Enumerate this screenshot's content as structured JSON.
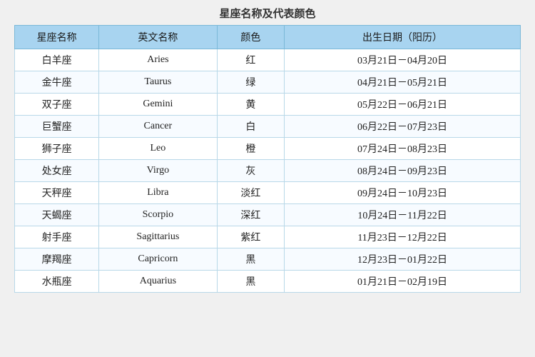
{
  "title": "星座名称及代表颜色",
  "headers": {
    "zh_name": "星座名称",
    "en_name": "英文名称",
    "color": "颜色",
    "date": "出生日期（阳历）"
  },
  "rows": [
    {
      "zh": "白羊座",
      "en": "Aries",
      "color": "红",
      "date": "03月21日－04月20日"
    },
    {
      "zh": "金牛座",
      "en": "Taurus",
      "color": "绿",
      "date": "04月21日－05月21日"
    },
    {
      "zh": "双子座",
      "en": "Gemini",
      "color": "黄",
      "date": "05月22日－06月21日"
    },
    {
      "zh": "巨蟹座",
      "en": "Cancer",
      "color": "白",
      "date": "06月22日－07月23日"
    },
    {
      "zh": "狮子座",
      "en": "Leo",
      "color": "橙",
      "date": "07月24日－08月23日"
    },
    {
      "zh": "处女座",
      "en": "Virgo",
      "color": "灰",
      "date": "08月24日－09月23日"
    },
    {
      "zh": "天秤座",
      "en": "Libra",
      "color": "淡红",
      "date": "09月24日－10月23日"
    },
    {
      "zh": "天蝎座",
      "en": "Scorpio",
      "color": "深红",
      "date": "10月24日－11月22日"
    },
    {
      "zh": "射手座",
      "en": "Sagittarius",
      "color": "紫红",
      "date": "11月23日－12月22日"
    },
    {
      "zh": "摩羯座",
      "en": "Capricorn",
      "color": "黑",
      "date": "12月23日－01月22日"
    },
    {
      "zh": "水瓶座",
      "en": "Aquarius",
      "color": "黑",
      "date": "01月21日－02月19日"
    }
  ]
}
